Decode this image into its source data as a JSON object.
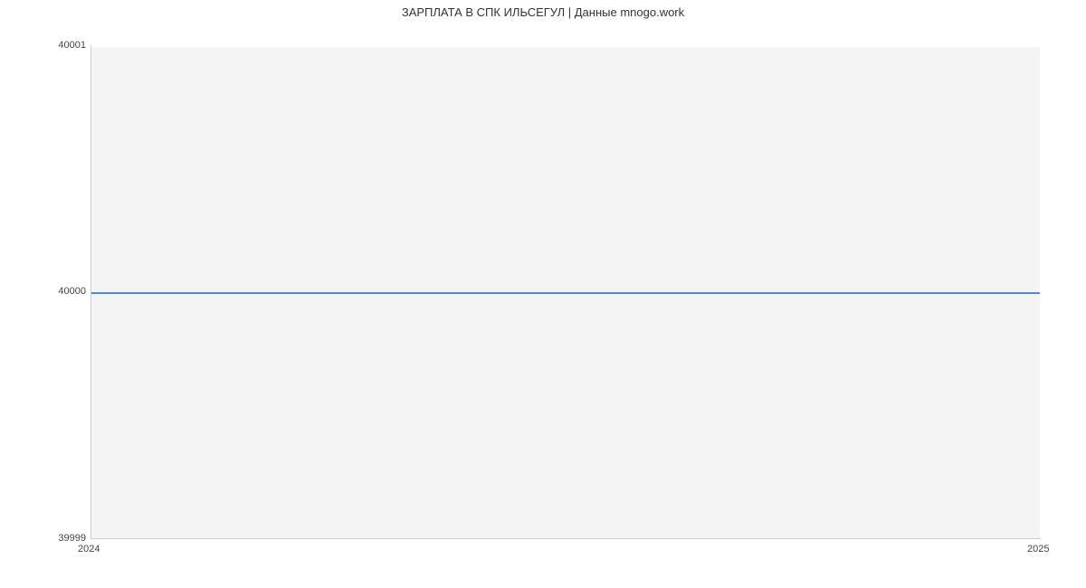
{
  "chart_data": {
    "type": "line",
    "title": "ЗАРПЛАТА В СПК ИЛЬСЕГУЛ | Данные mnogo.work",
    "xlabel": "",
    "ylabel": "",
    "x": [
      2024,
      2025
    ],
    "values": [
      40000,
      40000
    ],
    "y_ticks": [
      39999,
      40000,
      40001
    ],
    "x_ticks": [
      2024,
      2025
    ],
    "ylim": [
      39999,
      40001
    ],
    "xlim": [
      2024,
      2025
    ]
  }
}
